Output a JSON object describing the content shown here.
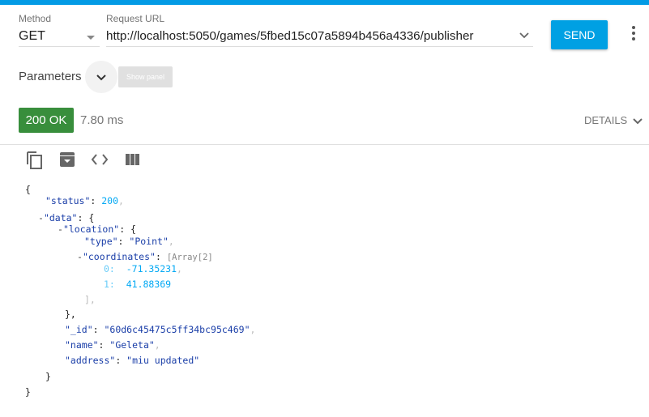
{
  "request": {
    "method_label": "Method",
    "method": "GET",
    "url_label": "Request URL",
    "url": "http://localhost:5050/games/5fbed15c07a5894b456a4336/publisher",
    "send": "SEND"
  },
  "parameters": {
    "label": "Parameters",
    "show_panel": "Show panel"
  },
  "response": {
    "status": "200 OK",
    "time": "7.80 ms",
    "details": "DETAILS",
    "status_color": "#388e3c"
  },
  "toolbar": {
    "icons": [
      "copy-icon",
      "archive-icon",
      "code-icon",
      "columns-icon"
    ]
  },
  "json": {
    "open": "{",
    "close": "}",
    "status_key": "\"status\"",
    "status_val": "200",
    "data_key": "\"data\"",
    "location_key": "\"location\"",
    "type_key": "\"type\"",
    "type_val": "\"Point\"",
    "coords_key": "\"coordinates\"",
    "coords_meta": "[Array[2]",
    "c0_idx": "0:",
    "c0_val": "-71.35231",
    "c1_idx": "1:",
    "c1_val": "41.88369",
    "arr_close": "],",
    "loc_close": "},",
    "id_key": "\"_id\"",
    "id_val": "\"60d6c45475c5ff34bc95c469\"",
    "name_key": "\"name\"",
    "name_val": "\"Geleta\"",
    "addr_key": "\"address\"",
    "addr_val": "\"miu updated\"",
    "data_close": "}"
  }
}
